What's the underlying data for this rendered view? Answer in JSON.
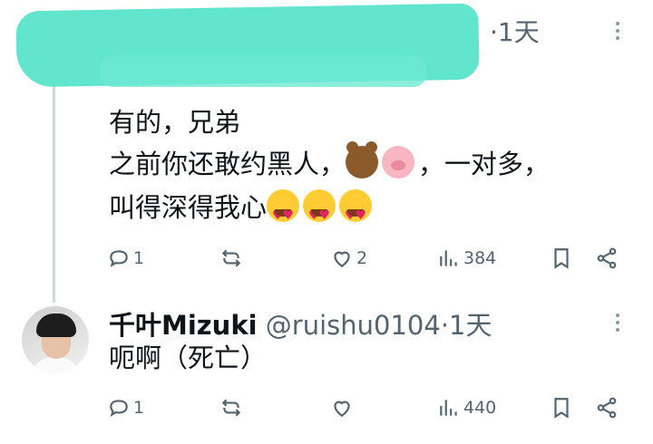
{
  "reply1": {
    "time": "·1天",
    "lines": [
      "有的，兄弟",
      "之前你还敢约黑人，",
      "，一对多，",
      "叫得深得我心"
    ],
    "stats": {
      "replies": "1",
      "reposts": "",
      "likes": "2",
      "views": "384"
    }
  },
  "reply2": {
    "name": "千叶Mizuki",
    "handle": "@ruishu0104",
    "time": "·1天",
    "text": "呃啊（死亡）",
    "stats": {
      "replies": "1",
      "reposts": "",
      "likes": "",
      "views": "440"
    }
  }
}
